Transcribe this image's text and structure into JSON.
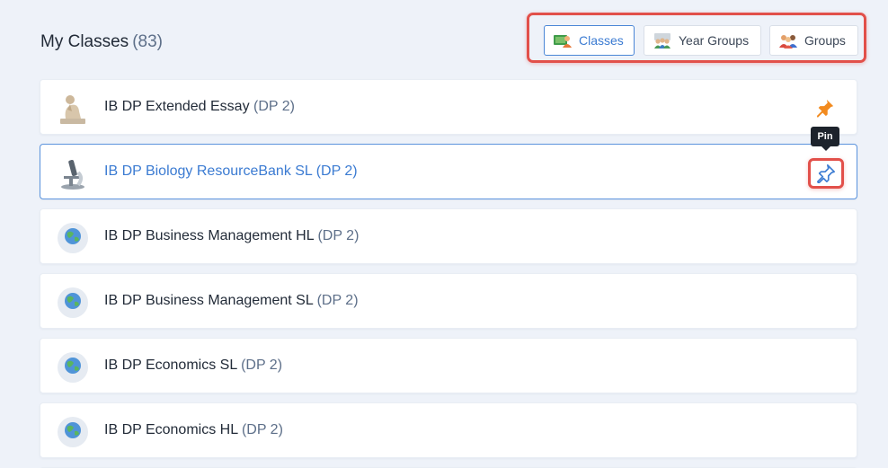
{
  "header": {
    "title": "My Classes",
    "count": "(83)"
  },
  "view_switch": {
    "classes_label": "Classes",
    "year_groups_label": "Year Groups",
    "groups_label": "Groups",
    "active": "Classes"
  },
  "tooltip": {
    "text": "Pin"
  },
  "classes": [
    {
      "name": "IB DP Extended Essay",
      "grade": "(DP 2)",
      "icon": "thinker-statue-icon",
      "pinned": true
    },
    {
      "name": "IB DP Biology ResourceBank SL",
      "grade": "(DP 2)",
      "icon": "microscope-icon",
      "pinned": false,
      "hovered": true
    },
    {
      "name": "IB DP Business Management HL",
      "grade": "(DP 2)",
      "icon": "globe-icon",
      "pinned": false
    },
    {
      "name": "IB DP Business Management SL",
      "grade": "(DP 2)",
      "icon": "globe-icon",
      "pinned": false
    },
    {
      "name": "IB DP Economics SL",
      "grade": "(DP 2)",
      "icon": "globe-icon",
      "pinned": false
    },
    {
      "name": "IB DP Economics HL",
      "grade": "(DP 2)",
      "icon": "globe-icon",
      "pinned": false
    }
  ],
  "colors": {
    "accent": "#3b7bd2",
    "highlight_box": "#e2504a",
    "pin_active": "#f28a1e",
    "background": "#eef2f9"
  }
}
